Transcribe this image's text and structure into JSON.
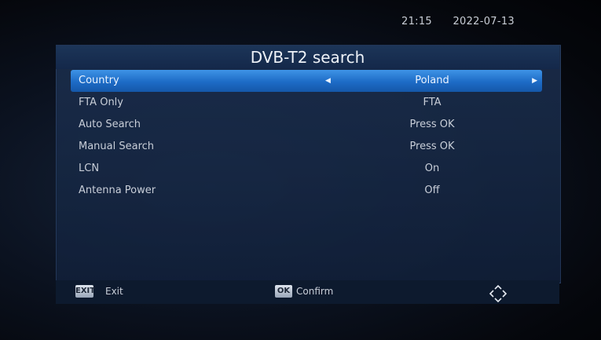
{
  "clock": {
    "time": "21:15",
    "date": "2022-07-13"
  },
  "title": "DVB-T2 search",
  "rows": [
    {
      "label": "Country",
      "value": "Poland"
    },
    {
      "label": "FTA Only",
      "value": "FTA"
    },
    {
      "label": "Auto Search",
      "value": "Press OK"
    },
    {
      "label": "Manual Search",
      "value": "Press OK"
    },
    {
      "label": "LCN",
      "value": "On"
    },
    {
      "label": "Antenna Power",
      "value": "Off"
    }
  ],
  "footer": {
    "exit_key": "EXIT",
    "exit_label": "Exit",
    "ok_key": "OK",
    "ok_label": "Confirm"
  },
  "colors": {
    "highlight": "#2b7fd8",
    "panel": "#14284a"
  },
  "icons": {
    "dpad": "navigation-dpad-icon"
  }
}
